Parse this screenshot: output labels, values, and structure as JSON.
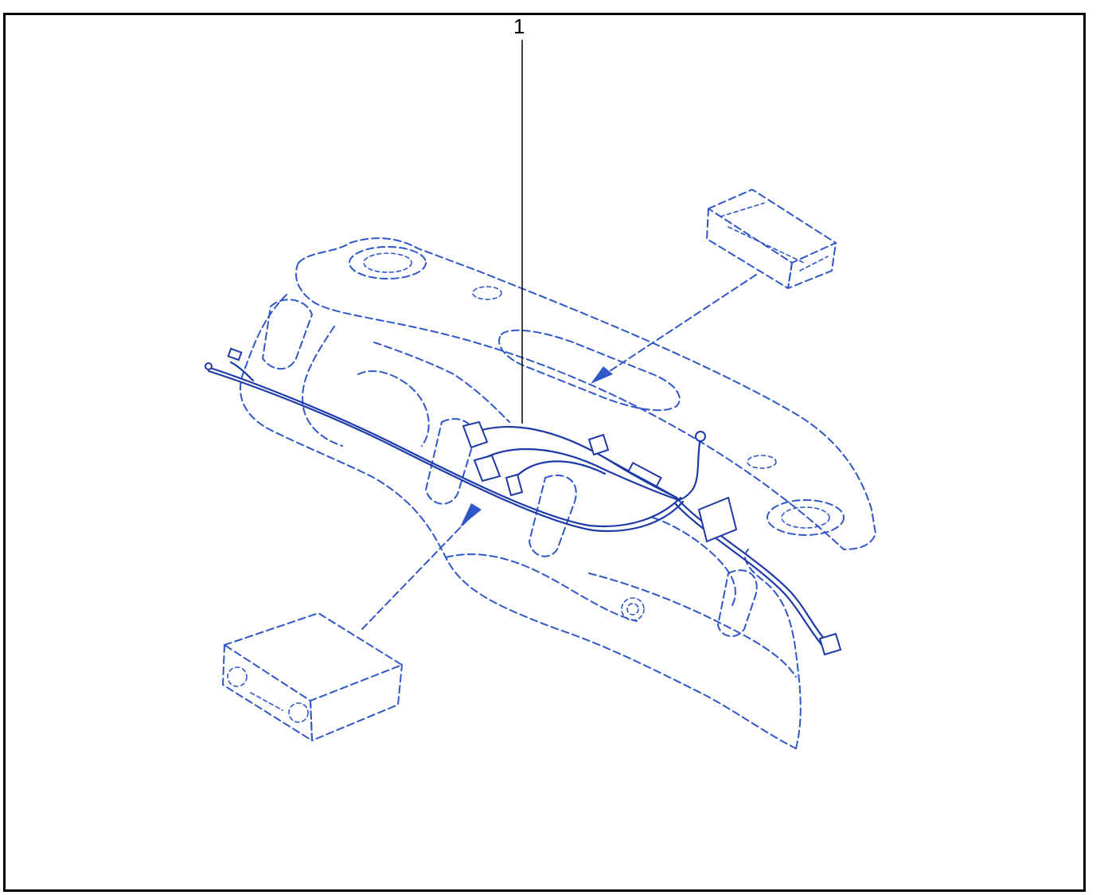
{
  "diagram": {
    "callouts": [
      {
        "number": "1"
      }
    ]
  },
  "colors": {
    "part_outline": "#2f57c8",
    "harness": "#1d3aa8",
    "leader": "#000000",
    "frame": "#000000"
  }
}
